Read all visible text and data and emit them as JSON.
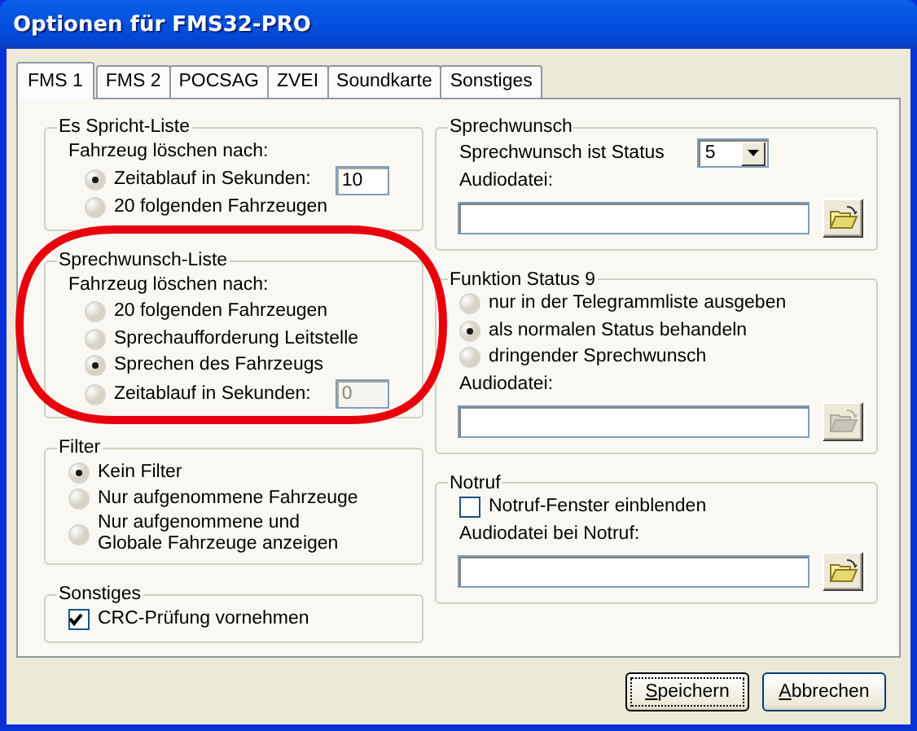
{
  "window": {
    "title": "Optionen für FMS32-PRO"
  },
  "tabs": [
    {
      "label": "FMS 1",
      "selected": true
    },
    {
      "label": "FMS 2",
      "selected": false
    },
    {
      "label": "POCSAG",
      "selected": false
    },
    {
      "label": "ZVEI",
      "selected": false
    },
    {
      "label": "Soundkarte",
      "selected": false
    },
    {
      "label": "Sonstiges",
      "selected": false
    }
  ],
  "left_groups": [
    {
      "title": "Es Spricht-Liste",
      "items": [
        {
          "kind": "label",
          "text": "Fahrzeug löschen nach:"
        },
        {
          "kind": "radio",
          "label": "Zeitablauf in Sekunden:",
          "selected": true,
          "field": {
            "value": "10",
            "disabled": false
          }
        },
        {
          "kind": "radio",
          "label": "20 folgenden Fahrzeugen",
          "selected": false
        }
      ]
    },
    {
      "title": "Sprechwunsch-Liste",
      "items": [
        {
          "kind": "label",
          "text": "Fahrzeug löschen nach:"
        },
        {
          "kind": "radio",
          "label": "20 folgenden Fahrzeugen",
          "selected": false
        },
        {
          "kind": "radio",
          "label": "Sprechaufforderung Leitstelle",
          "selected": false
        },
        {
          "kind": "radio",
          "label": "Sprechen des Fahrzeugs",
          "selected": true
        },
        {
          "kind": "radio",
          "label": "Zeitablauf in Sekunden:",
          "selected": false,
          "field": {
            "value": "0",
            "disabled": true
          }
        }
      ]
    },
    {
      "title": "Filter",
      "items": [
        {
          "kind": "radio",
          "label": "Kein Filter",
          "selected": true
        },
        {
          "kind": "radio",
          "label": "Nur aufgenommene Fahrzeuge",
          "selected": false
        },
        {
          "kind": "radio",
          "label": "Nur aufgenommene und\nGlobale Fahrzeuge anzeigen",
          "selected": false
        }
      ]
    },
    {
      "title": "Sonstiges",
      "items": [
        {
          "kind": "checkbox",
          "label": "CRC-Prüfung vornehmen",
          "checked": true
        }
      ]
    }
  ],
  "right_groups": [
    {
      "title": "Sprechwunsch",
      "items": [
        {
          "kind": "select",
          "label": "Sprechwunsch ist Status",
          "value": "5"
        },
        {
          "kind": "label",
          "text": "Audiodatei:"
        },
        {
          "kind": "file",
          "disabled": false
        }
      ]
    },
    {
      "title": "Funktion Status 9",
      "items": [
        {
          "kind": "radio",
          "label": "nur in der Telegrammliste ausgeben",
          "selected": false
        },
        {
          "kind": "radio",
          "label": "als normalen Status behandeln",
          "selected": true
        },
        {
          "kind": "radio",
          "label": "dringender Sprechwunsch",
          "selected": false
        },
        {
          "kind": "label",
          "text": "Audiodatei:"
        },
        {
          "kind": "file",
          "disabled": true
        }
      ]
    },
    {
      "title": "Notruf",
      "items": [
        {
          "kind": "checkbox",
          "label": "Notruf-Fenster einblenden",
          "checked": false
        },
        {
          "kind": "label",
          "text": "Audiodatei bei Notruf:"
        },
        {
          "kind": "file",
          "disabled": false
        }
      ]
    }
  ],
  "buttons": [
    {
      "label": "Speichern",
      "default": true
    },
    {
      "label": "Abbrechen",
      "default": false
    }
  ],
  "annotations": [
    {
      "kind": "ellipse"
    }
  ]
}
